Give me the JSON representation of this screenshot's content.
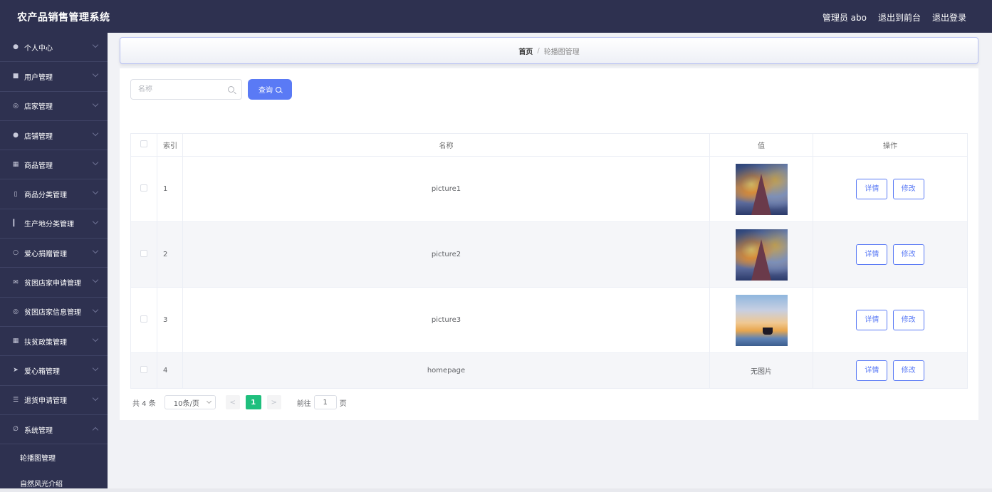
{
  "app": {
    "title": "农产品销售管理系统",
    "user_label": "管理员 abo",
    "to_front": "退出到前台",
    "logout": "退出登录"
  },
  "sidebar": {
    "items": [
      {
        "label": "个人中心",
        "icon": "user-icon"
      },
      {
        "label": "用户管理",
        "icon": "users-icon"
      },
      {
        "label": "店家管理",
        "icon": "store-icon"
      },
      {
        "label": "店铺管理",
        "icon": "shop-icon"
      },
      {
        "label": "商品管理",
        "icon": "goods-icon"
      },
      {
        "label": "商品分类管理",
        "icon": "category-icon"
      },
      {
        "label": "生产地分类管理",
        "icon": "chart-icon"
      },
      {
        "label": "爱心捐赠管理",
        "icon": "mic-icon"
      },
      {
        "label": "贫困店家申请管理",
        "icon": "mail-icon"
      },
      {
        "label": "贫困店家信息管理",
        "icon": "info-icon"
      },
      {
        "label": "扶贫政策管理",
        "icon": "policy-icon"
      },
      {
        "label": "爱心箱管理",
        "icon": "send-icon"
      },
      {
        "label": "退货申请管理",
        "icon": "sliders-icon"
      },
      {
        "label": "系统管理",
        "icon": "system-icon"
      }
    ],
    "submenu": [
      "轮播图管理",
      "自然风光介绍"
    ]
  },
  "breadcrumb": {
    "home": "首页",
    "separator": "/",
    "current": "轮播图管理"
  },
  "search": {
    "placeholder": "名称",
    "button": "查询"
  },
  "table": {
    "headers": [
      "索引",
      "名称",
      "值",
      "操作"
    ],
    "rows": [
      {
        "index": "1",
        "name": "picture1",
        "value": "image",
        "image": "mountain-sunset-painting"
      },
      {
        "index": "2",
        "name": "picture2",
        "value": "image",
        "image": "mountain-sunset-painting"
      },
      {
        "index": "3",
        "name": "picture3",
        "value": "image",
        "image": "sea-sunset-boat"
      },
      {
        "index": "4",
        "name": "homepage",
        "value": "无图片",
        "image": ""
      }
    ],
    "detail_label": "详情",
    "edit_label": "修改"
  },
  "pagination": {
    "total": "共 4 条",
    "page_size": "10条/页",
    "prev": "<",
    "current_page": "1",
    "next": ">",
    "goto_label": "前往",
    "goto_value": "1",
    "goto_unit": "页"
  },
  "colors": {
    "sidebar_bg": "#2e3150",
    "accent": "#5a7af5",
    "active_page": "#1fbf7d"
  }
}
